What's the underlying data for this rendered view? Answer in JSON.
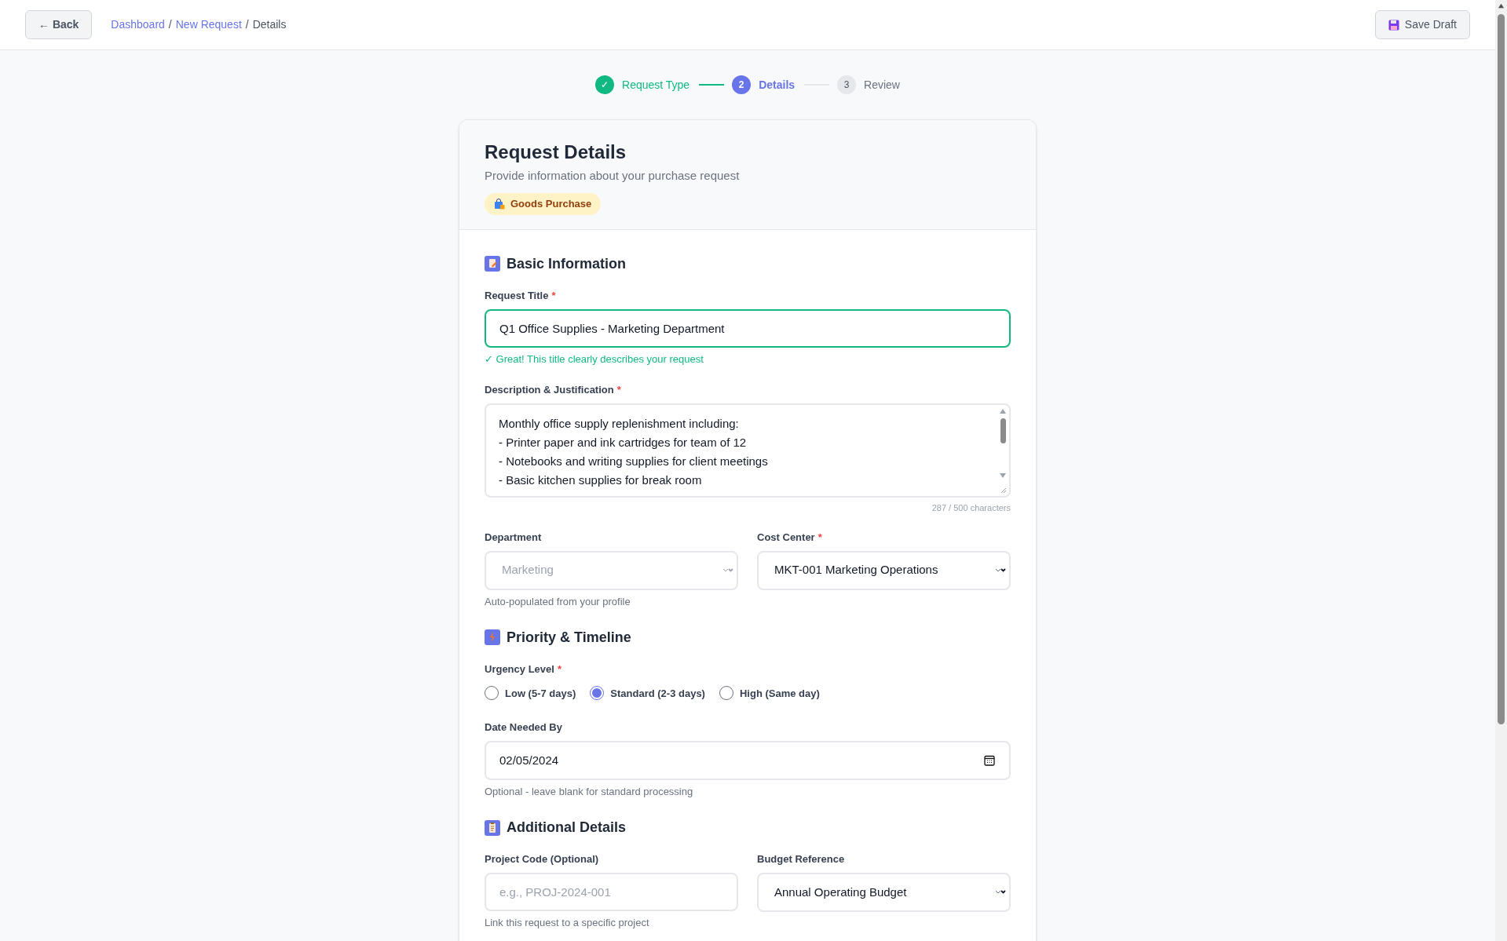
{
  "header": {
    "back_button": "← Back",
    "breadcrumbs": [
      {
        "label": "Dashboard",
        "kind": "link",
        "separator": "/"
      },
      {
        "label": "New Request",
        "kind": "link",
        "separator": "/"
      },
      {
        "label": "Details",
        "kind": "current"
      }
    ],
    "save_button": "Save Draft"
  },
  "stepper": [
    {
      "marker": "✓",
      "label": "Request Type",
      "completed": true,
      "selected": false
    },
    {
      "marker": "2",
      "label": "Details",
      "completed": false,
      "selected": true
    },
    {
      "marker": "3",
      "label": "Review",
      "completed": false,
      "selected": false
    }
  ],
  "card": {
    "title": "Request Details",
    "subtitle": "Provide information about your purchase request",
    "badge": "Goods Purchase"
  },
  "sections": [
    {
      "title": "Basic Information",
      "rows": [
        {
          "fields": [
            {
              "kind": "text",
              "label": "Request Title",
              "required_mark": "*",
              "value": "Q1 Office Supplies - Marketing Department",
              "valid": true,
              "hint": "✓ Great! This title clearly describes your request"
            }
          ]
        },
        {
          "fields": [
            {
              "kind": "textarea",
              "label": "Description & Justification",
              "required_mark": "*",
              "lines": [
                "Monthly office supply replenishment including:",
                "- Printer paper and ink cartridges for team of 12",
                "- Notebooks and writing supplies for client meetings",
                "- Basic kitchen supplies for break room"
              ],
              "counter": "287 / 500 characters"
            }
          ]
        },
        {
          "fields": [
            {
              "kind": "select",
              "label": "Department",
              "value": "Marketing",
              "disabled": true,
              "hint": "Auto-populated from your profile"
            },
            {
              "kind": "select",
              "label": "Cost Center",
              "required_mark": "*",
              "value": "MKT-001 Marketing Operations",
              "disabled": false
            }
          ]
        }
      ]
    },
    {
      "title": "Priority & Timeline",
      "rows": [
        {
          "fields": [
            {
              "kind": "radio",
              "label": "Urgency Level",
              "required_mark": "*",
              "options": [
                {
                  "label": "Low (5-7 days)",
                  "selected": false
                },
                {
                  "label": "Standard (2-3 days)",
                  "selected": true
                },
                {
                  "label": "High (Same day)",
                  "selected": false
                }
              ]
            }
          ]
        },
        {
          "fields": [
            {
              "kind": "date",
              "label": "Date Needed By",
              "value": "02/05/2024",
              "hint": "Optional - leave blank for standard processing"
            }
          ]
        }
      ]
    },
    {
      "title": "Additional Details",
      "rows": [
        {
          "fields": [
            {
              "kind": "text",
              "label": "Project Code (Optional)",
              "placeholder": "e.g., PROJ-2024-001",
              "valid": false,
              "hint": "Link this request to a specific project"
            },
            {
              "kind": "select",
              "label": "Budget Reference",
              "value": "Annual Operating Budget",
              "disabled": false
            }
          ]
        }
      ]
    }
  ]
}
